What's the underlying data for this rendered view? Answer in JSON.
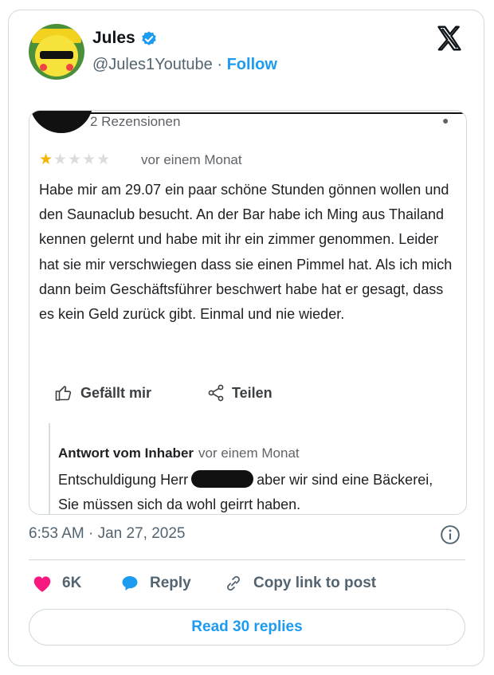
{
  "author": {
    "name": "Jules",
    "handle": "@Jules1Youtube",
    "separator": " · ",
    "follow_label": "Follow"
  },
  "review": {
    "count_label": "2 Rezensionen",
    "rating": 1,
    "max_rating": 5,
    "time": "vor einem Monat",
    "text": "Habe mir am 29.07 ein paar schöne Stunden gönnen wollen und den Saunaclub besucht. An der Bar habe ich Ming aus Thailand kennen gelernt und habe mit ihr ein zimmer genommen. Leider hat sie mir verschwiegen dass sie einen Pimmel hat. Als ich mich dann beim Geschäftsführer beschwert habe hat er gesagt, dass es kein Geld zurück gibt. Einmal und nie wieder.",
    "like_label": "Gefällt mir",
    "share_label": "Teilen",
    "owner_label": "Antwort vom Inhaber",
    "owner_time": "vor einem Monat",
    "owner_text_before": "Entschuldigung Herr",
    "owner_text_after": "aber wir sind eine Bäckerei, Sie müssen sich da wohl geirrt haben."
  },
  "post": {
    "timestamp": "6:53 AM · Jan 27, 2025",
    "likes": "6K",
    "reply_label": "Reply",
    "copy_link_label": "Copy link to post",
    "read_replies_label": "Read 30 replies"
  },
  "colors": {
    "accent": "#1d9bf0",
    "heart": "#f91880",
    "star": "#f4b400",
    "secondary_text": "#536471"
  }
}
